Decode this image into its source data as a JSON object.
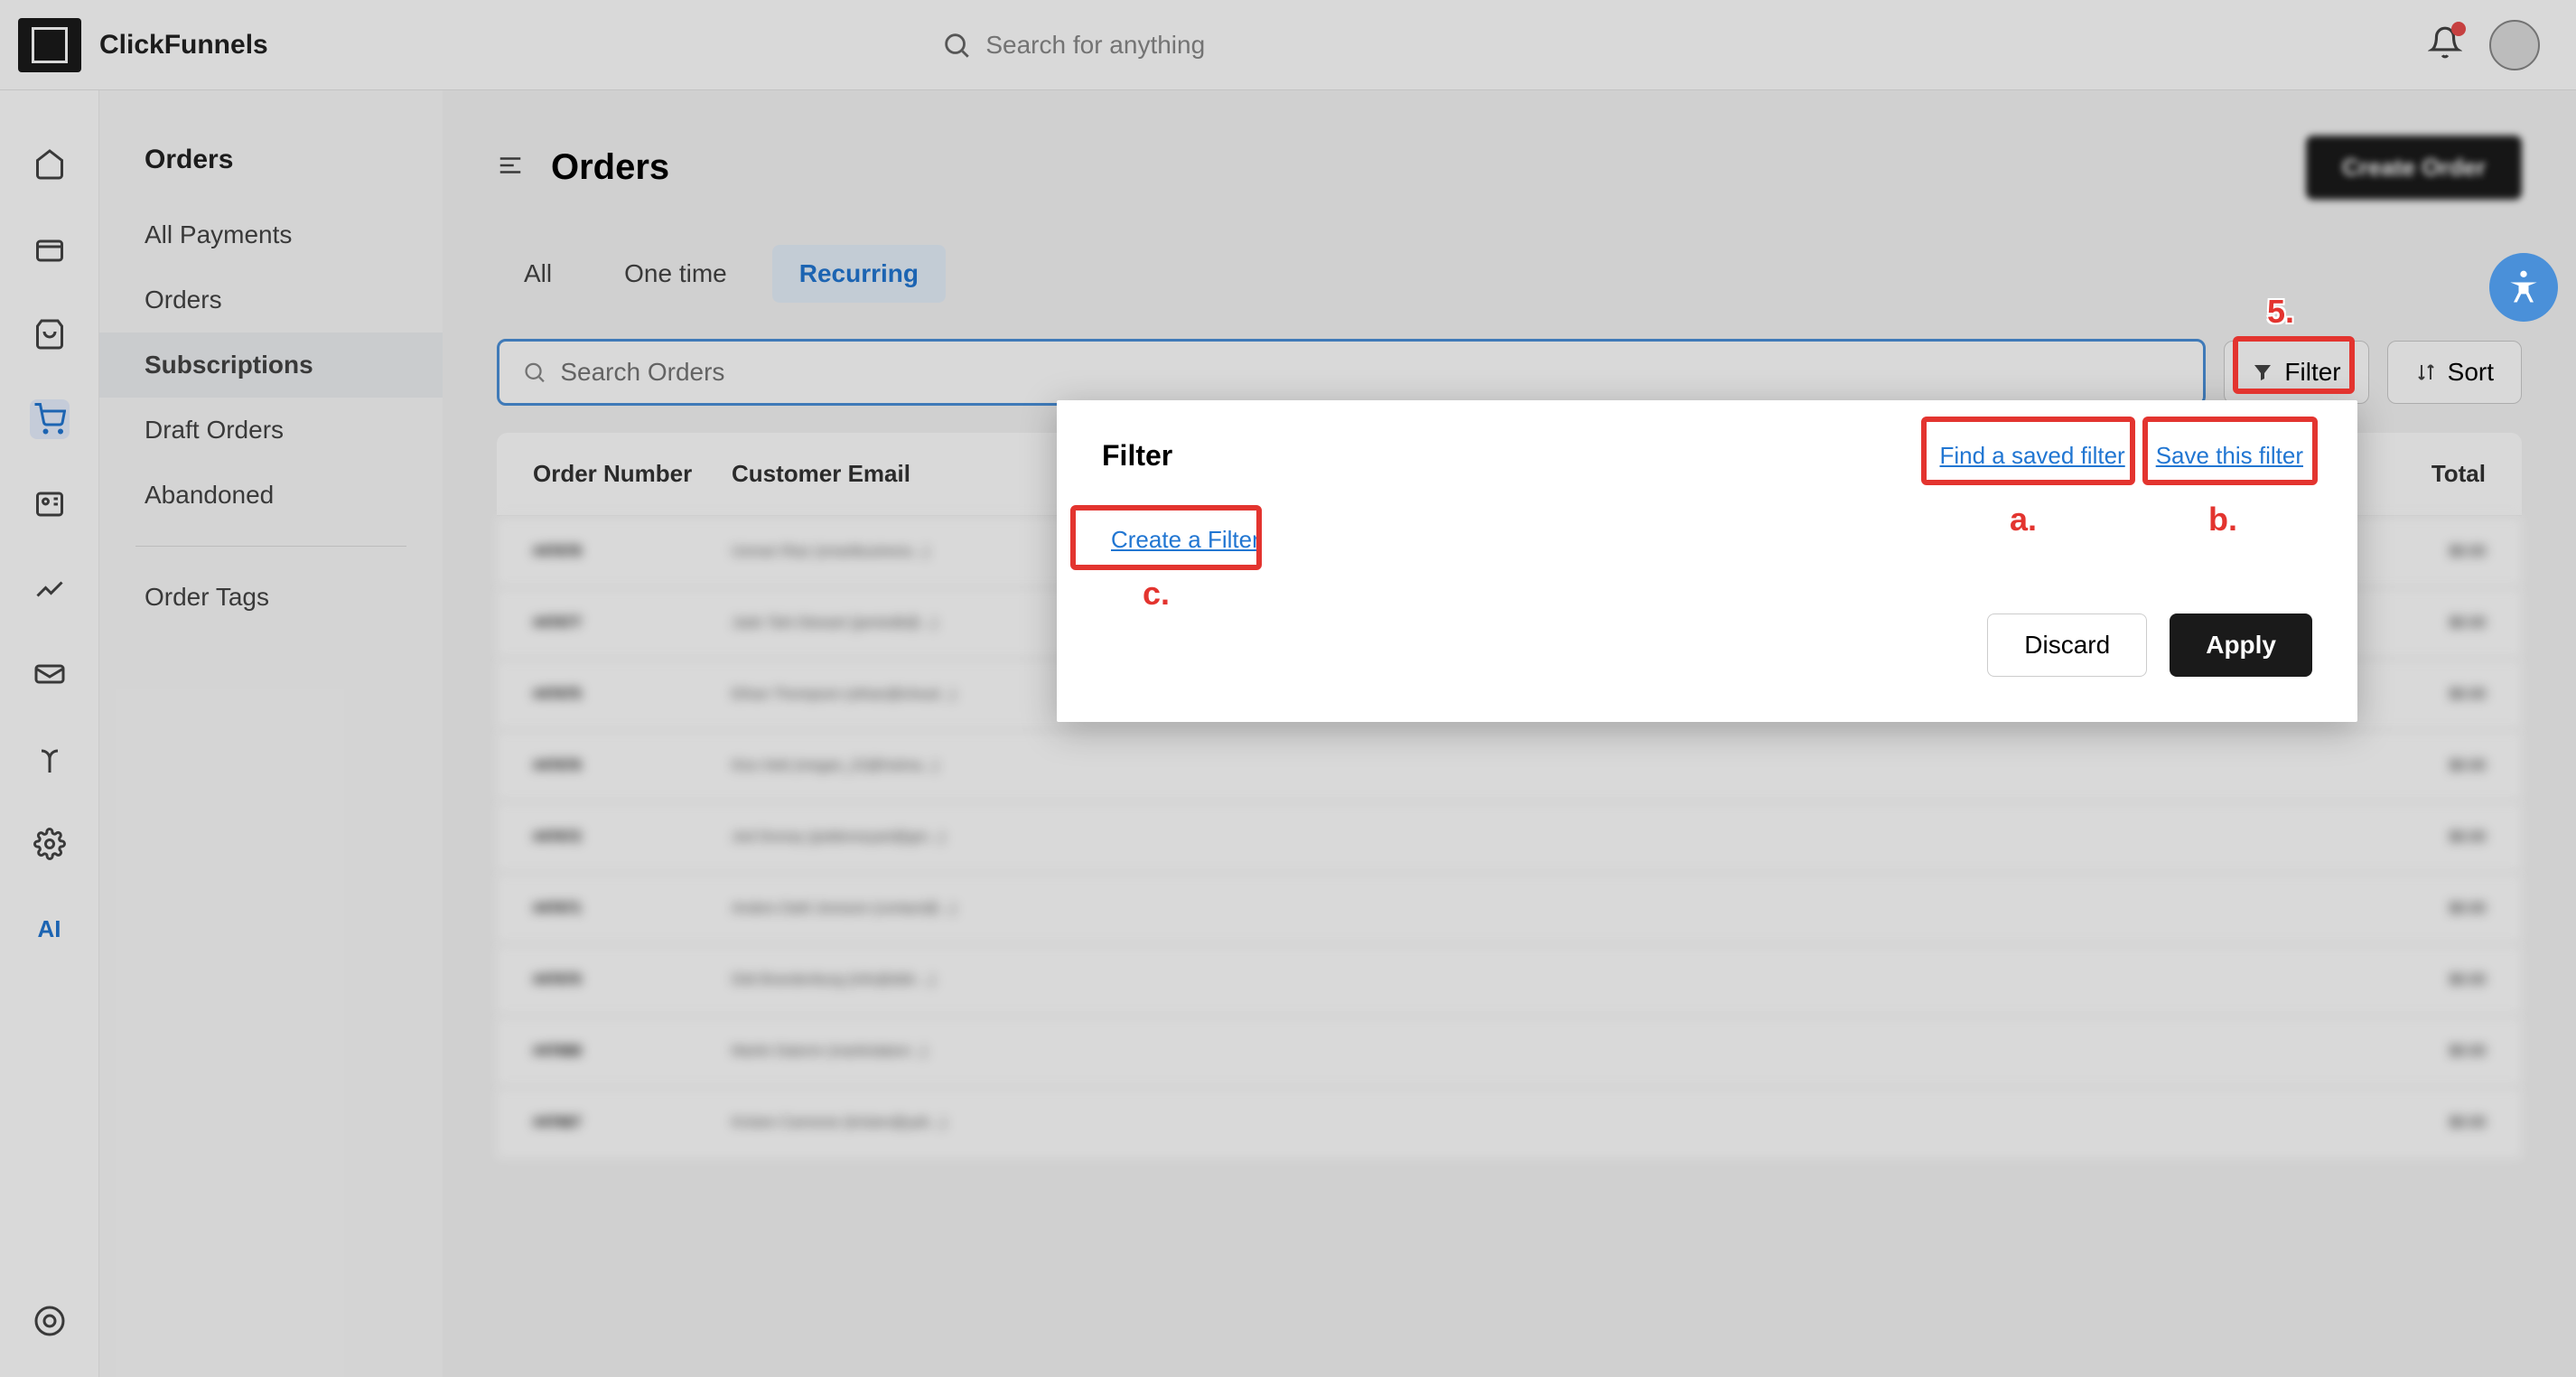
{
  "header": {
    "brand": "ClickFunnels",
    "search_placeholder": "Search for anything"
  },
  "sidebar": {
    "heading": "Orders",
    "items": [
      {
        "label": "All Payments"
      },
      {
        "label": "Orders"
      },
      {
        "label": "Subscriptions",
        "active": true
      },
      {
        "label": "Draft Orders"
      },
      {
        "label": "Abandoned"
      }
    ],
    "after_divider": [
      {
        "label": "Order Tags"
      }
    ]
  },
  "page": {
    "title": "Orders",
    "create_button": "Create Order"
  },
  "tabs": [
    {
      "label": "All"
    },
    {
      "label": "One time"
    },
    {
      "label": "Recurring",
      "active": true
    }
  ],
  "search_orders_placeholder": "Search Orders",
  "toolbar": {
    "filter_label": "Filter",
    "sort_label": "Sort"
  },
  "table": {
    "columns": {
      "order": "Order Number",
      "email": "Customer Email",
      "total": "Total"
    },
    "rows": [
      {
        "order": "#47678",
        "email": "Usman Riaz (smartbusiness...)",
        "total": "$0.00"
      },
      {
        "order": "#47677",
        "email": "Jade Tahi-Stewart (jamiedk@...)",
        "total": "$0.00"
      },
      {
        "order": "#47675",
        "email": "Ethan Thompson (ethan@icloud...)",
        "total": "$0.00"
      },
      {
        "order": "#47676",
        "email": "Kira Vetti (megan_22@hotma...)",
        "total": "$0.00"
      },
      {
        "order": "#47672",
        "email": "Jed Dorsey (jeddorseyart@gm...)",
        "total": "$0.00"
      },
      {
        "order": "#47671",
        "email": "Anders Dahl Jonsson (contact@...)",
        "total": "$0.00"
      },
      {
        "order": "#47670",
        "email": "Didi Brandenburg (info@didi-...)",
        "total": "$0.00"
      },
      {
        "order": "#47668",
        "email": "Martin Datorre (martindatorr...)",
        "total": "$0.00"
      },
      {
        "order": "#47667",
        "email": "Kristen Carmone (kristen@yah...)",
        "total": "$0.00"
      }
    ]
  },
  "filter_popover": {
    "title": "Filter",
    "find_saved": "Find a saved filter",
    "save_this": "Save this filter",
    "create_filter": "Create a Filter",
    "discard": "Discard",
    "apply": "Apply"
  },
  "annotations": {
    "number5": "5.",
    "a": "a.",
    "b": "b.",
    "c": "c."
  }
}
